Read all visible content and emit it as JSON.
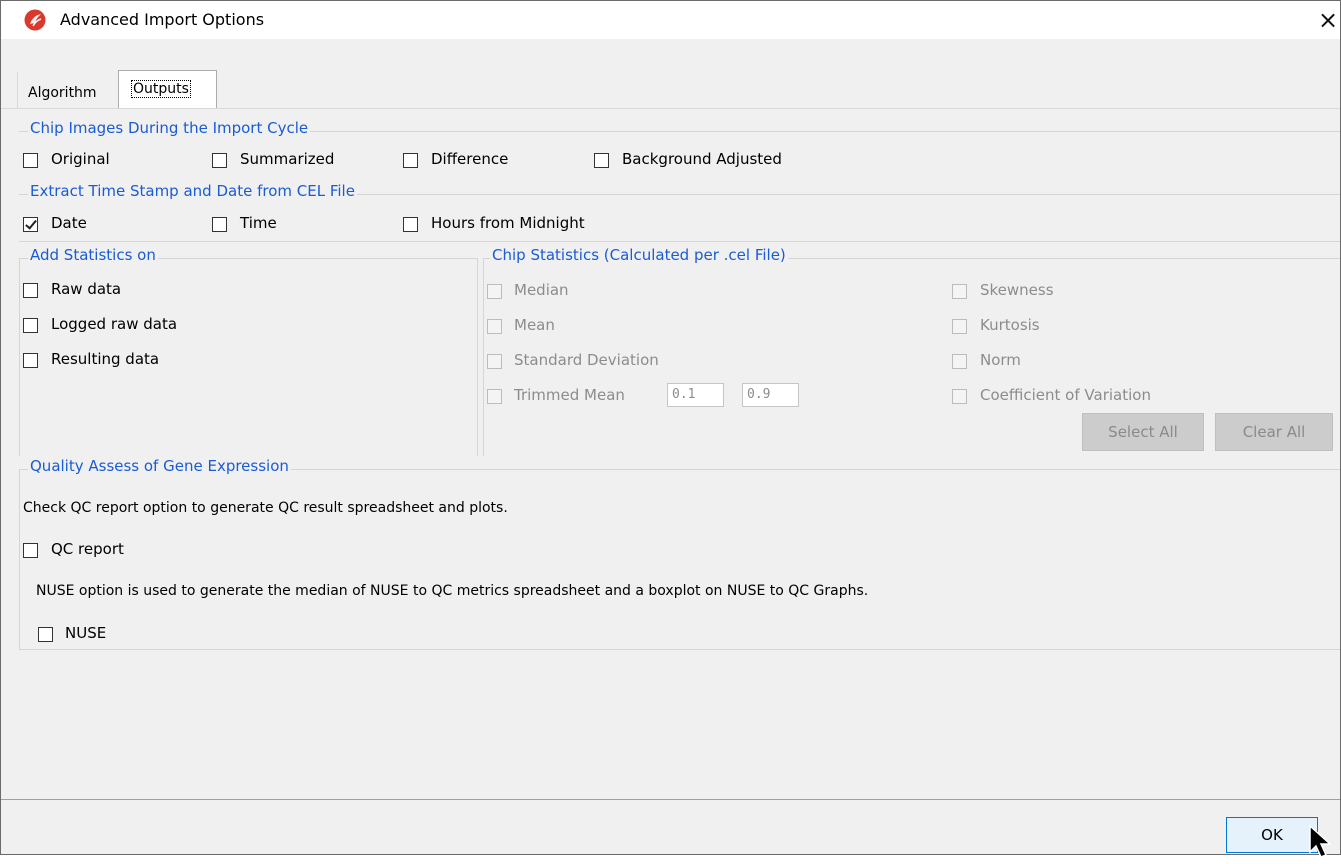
{
  "window": {
    "title": "Advanced Import Options",
    "close_symbol": "×",
    "icon": "app-logo-icon"
  },
  "tabs": [
    {
      "label": "Algorithm",
      "selected": false
    },
    {
      "label": "Outputs",
      "selected": true
    }
  ],
  "chip_images": {
    "legend": "Chip Images During the Import Cycle",
    "options": [
      {
        "label": "Original",
        "checked": false
      },
      {
        "label": "Summarized",
        "checked": false
      },
      {
        "label": "Difference",
        "checked": false
      },
      {
        "label": "Background Adjusted",
        "checked": false
      }
    ]
  },
  "timestamp": {
    "legend": "Extract Time Stamp and Date from CEL File",
    "options": [
      {
        "label": "Date",
        "checked": true
      },
      {
        "label": "Time",
        "checked": false
      },
      {
        "label": "Hours from Midnight",
        "checked": false
      }
    ]
  },
  "add_statistics": {
    "legend": "Add Statistics on",
    "options": [
      {
        "label": "Raw data",
        "checked": false
      },
      {
        "label": "Logged raw data",
        "checked": false
      },
      {
        "label": "Resulting data",
        "checked": false
      }
    ]
  },
  "chip_statistics": {
    "legend": "Chip Statistics (Calculated per .cel File)",
    "left_options": [
      {
        "label": "Median",
        "checked": false
      },
      {
        "label": "Mean",
        "checked": false
      },
      {
        "label": "Standard Deviation",
        "checked": false
      },
      {
        "label": "Trimmed Mean",
        "checked": false
      }
    ],
    "right_options": [
      {
        "label": "Skewness",
        "checked": false
      },
      {
        "label": "Kurtosis",
        "checked": false
      },
      {
        "label": "Norm",
        "checked": false
      },
      {
        "label": "Coefficient of Variation",
        "checked": false
      }
    ],
    "trimmed_low": "0.1",
    "trimmed_high": "0.9",
    "select_all": "Select All",
    "clear_all": "Clear All"
  },
  "quality": {
    "legend": "Quality Assess of Gene Expression",
    "description": "Check QC report option to generate QC result spreadsheet and plots.",
    "qc_report_label": "QC report",
    "qc_report_checked": false,
    "nuse_description": "NUSE option is used to generate the median of NUSE to QC metrics spreadsheet and a boxplot on NUSE to QC Graphs.",
    "nuse_label": "NUSE",
    "nuse_checked": false
  },
  "footer": {
    "ok_label": "OK"
  }
}
